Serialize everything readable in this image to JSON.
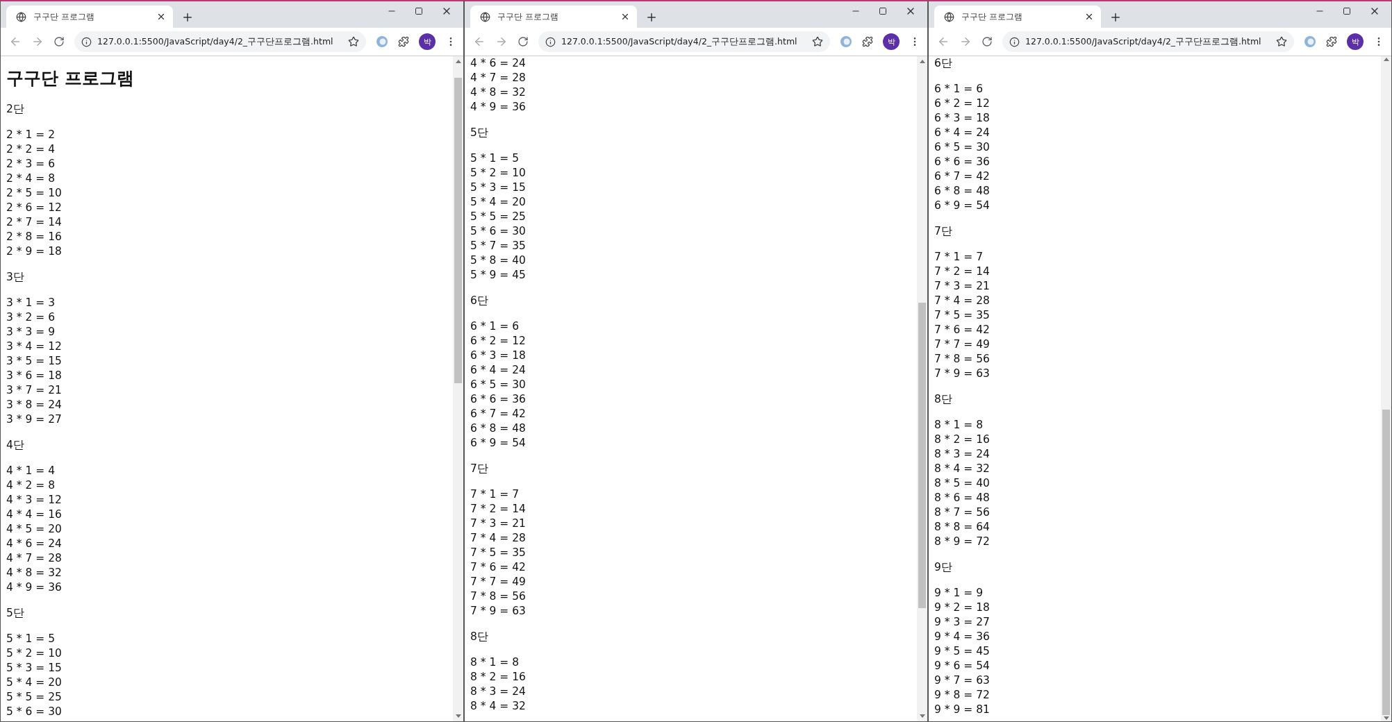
{
  "windows": [
    {
      "tab_title": "구구단 프로그램",
      "url": "127.0.0.1:5500/JavaScript/day4/2_구구단프로그램.html",
      "avatar": "박",
      "heading": "구구단 프로그램",
      "sections": [
        {
          "label": "2단",
          "lines": [
            "2 * 1 = 2",
            "2 * 2 = 4",
            "2 * 3 = 6",
            "2 * 4 = 8",
            "2 * 5 = 10",
            "2 * 6 = 12",
            "2 * 7 = 14",
            "2 * 8 = 16",
            "2 * 9 = 18"
          ]
        },
        {
          "label": "3단",
          "lines": [
            "3 * 1 = 3",
            "3 * 2 = 6",
            "3 * 3 = 9",
            "3 * 4 = 12",
            "3 * 5 = 15",
            "3 * 6 = 18",
            "3 * 7 = 21",
            "3 * 8 = 24",
            "3 * 9 = 27"
          ]
        },
        {
          "label": "4단",
          "lines": [
            "4 * 1 = 4",
            "4 * 2 = 8",
            "4 * 3 = 12",
            "4 * 4 = 16",
            "4 * 5 = 20",
            "4 * 6 = 24",
            "4 * 7 = 28",
            "4 * 8 = 32",
            "4 * 9 = 36"
          ]
        },
        {
          "label": "5단",
          "lines": [
            "5 * 1 = 5",
            "5 * 2 = 10",
            "5 * 3 = 15",
            "5 * 4 = 20",
            "5 * 5 = 25",
            "5 * 6 = 30"
          ]
        }
      ]
    },
    {
      "tab_title": "구구단 프로그램",
      "url": "127.0.0.1:5500/JavaScript/day4/2_구구단프로그램.html",
      "avatar": "박",
      "sections": [
        {
          "lines": [
            "4 * 6 = 24",
            "4 * 7 = 28",
            "4 * 8 = 32",
            "4 * 9 = 36"
          ]
        },
        {
          "label": "5단",
          "lines": [
            "5 * 1 = 5",
            "5 * 2 = 10",
            "5 * 3 = 15",
            "5 * 4 = 20",
            "5 * 5 = 25",
            "5 * 6 = 30",
            "5 * 7 = 35",
            "5 * 8 = 40",
            "5 * 9 = 45"
          ]
        },
        {
          "label": "6단",
          "lines": [
            "6 * 1 = 6",
            "6 * 2 = 12",
            "6 * 3 = 18",
            "6 * 4 = 24",
            "6 * 5 = 30",
            "6 * 6 = 36",
            "6 * 7 = 42",
            "6 * 8 = 48",
            "6 * 9 = 54"
          ]
        },
        {
          "label": "7단",
          "lines": [
            "7 * 1 = 7",
            "7 * 2 = 14",
            "7 * 3 = 21",
            "7 * 4 = 28",
            "7 * 5 = 35",
            "7 * 6 = 42",
            "7 * 7 = 49",
            "7 * 8 = 56",
            "7 * 9 = 63"
          ]
        },
        {
          "label": "8단",
          "lines": [
            "8 * 1 = 8",
            "8 * 2 = 16",
            "8 * 3 = 24",
            "8 * 4 = 32"
          ]
        }
      ]
    },
    {
      "tab_title": "구구단 프로그램",
      "url": "127.0.0.1:5500/JavaScript/day4/2_구구단프로그램.html",
      "avatar": "박",
      "sections": [
        {
          "label": "6단",
          "lines": [
            "6 * 1 = 6",
            "6 * 2 = 12",
            "6 * 3 = 18",
            "6 * 4 = 24",
            "6 * 5 = 30",
            "6 * 6 = 36",
            "6 * 7 = 42",
            "6 * 8 = 48",
            "6 * 9 = 54"
          ]
        },
        {
          "label": "7단",
          "lines": [
            "7 * 1 = 7",
            "7 * 2 = 14",
            "7 * 3 = 21",
            "7 * 4 = 28",
            "7 * 5 = 35",
            "7 * 6 = 42",
            "7 * 7 = 49",
            "7 * 8 = 56",
            "7 * 9 = 63"
          ]
        },
        {
          "label": "8단",
          "lines": [
            "8 * 1 = 8",
            "8 * 2 = 16",
            "8 * 3 = 24",
            "8 * 4 = 32",
            "8 * 5 = 40",
            "8 * 6 = 48",
            "8 * 7 = 56",
            "8 * 8 = 64",
            "8 * 9 = 72"
          ]
        },
        {
          "label": "9단",
          "lines": [
            "9 * 1 = 9",
            "9 * 2 = 18",
            "9 * 3 = 27",
            "9 * 4 = 36",
            "9 * 5 = 45",
            "9 * 6 = 54",
            "9 * 7 = 63",
            "9 * 8 = 72",
            "9 * 9 = 81"
          ]
        }
      ]
    }
  ]
}
